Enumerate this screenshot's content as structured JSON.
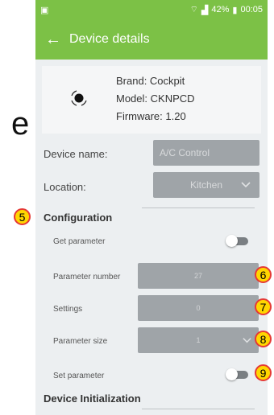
{
  "status_bar": {
    "left_icon": "screen-icon",
    "battery_text": "42%",
    "time": "00:05"
  },
  "app_bar": {
    "back_icon": "arrow-left-icon",
    "title": "Device details"
  },
  "device": {
    "brand": "Brand: Cockpit",
    "model": "Model: CKNPCD",
    "firmware": "Firmware: 1.20"
  },
  "device_name": {
    "label": "Device name:",
    "value": "A/C Control"
  },
  "location": {
    "label": "Location:",
    "value": "Kitchen"
  },
  "configuration": {
    "title": "Configuration",
    "get_parameter_label": "Get parameter",
    "parameter_number_label": "Parameter number",
    "parameter_number_value": "27",
    "settings_label": "Settings",
    "settings_value": "0",
    "parameter_size_label": "Parameter size",
    "parameter_size_value": "1",
    "set_parameter_label": "Set parameter"
  },
  "device_initialization": {
    "title": "Device Initialization"
  },
  "badges": {
    "b5": "5",
    "b6": "6",
    "b7": "7",
    "b8": "8",
    "b9": "9"
  },
  "bg_text": "e",
  "colors": {
    "accent": "#7cc146",
    "badge_fill": "#ffd600",
    "badge_border": "#e53935",
    "field": "#9fa4a8"
  }
}
